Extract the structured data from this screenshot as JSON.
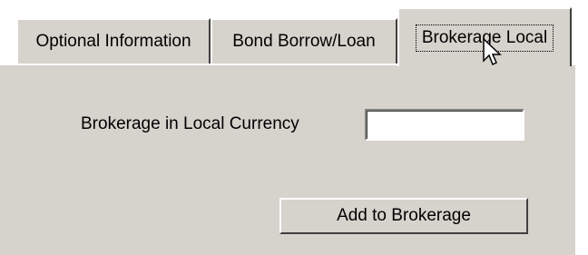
{
  "tabs": [
    {
      "label": "Optional Information",
      "active": false
    },
    {
      "label": "Bond Borrow/Loan",
      "active": false
    },
    {
      "label": "Brokerage Local",
      "active": true
    }
  ],
  "panel": {
    "field_label": "Brokerage in Local Currency",
    "field_value": "",
    "button_label": "Add to Brokerage"
  },
  "icons": {
    "cursor": "mouse-pointer-icon"
  },
  "colors": {
    "panel_bg": "#d6d2cc"
  }
}
